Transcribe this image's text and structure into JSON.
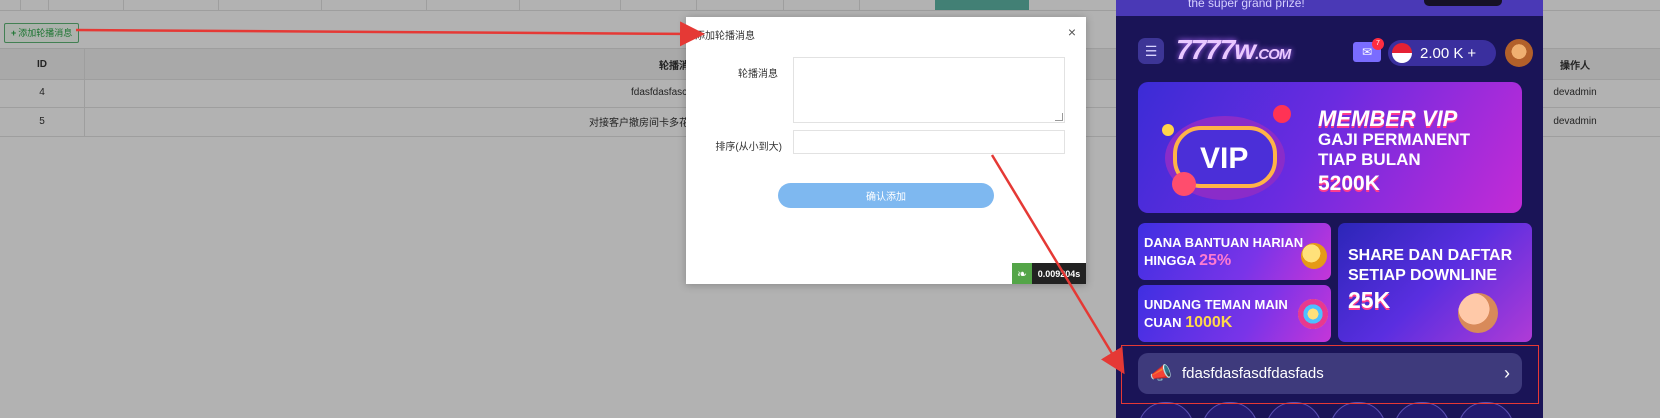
{
  "admin": {
    "add_button_label": "添加轮播消息",
    "table": {
      "headers": {
        "id": "ID",
        "message": "轮播消",
        "operator": "操作人"
      },
      "rows": [
        {
          "id": "4",
          "message": "fdasfdasfasc",
          "operator": "devadmin"
        },
        {
          "id": "5",
          "message": "对接客户撤房间卡多花时",
          "operator": "devadmin"
        }
      ]
    }
  },
  "modal": {
    "title": "添加轮播消息",
    "close_symbol": "×",
    "fields": {
      "message_label": "轮播消息",
      "message_value": "",
      "order_label": "排序(从小到大)",
      "order_value": ""
    },
    "confirm_label": "确认添加",
    "timer": "0.009204s"
  },
  "preview": {
    "top_banner_text": "the super grand prize!",
    "logo": "7777w",
    "logo_domain": ".COM",
    "mail_badge": "7",
    "balance": "2.00 K",
    "balance_plus": "+",
    "main_banner": {
      "title": "MEMBER VIP",
      "line1": "GAJI PERMANENT",
      "line2": "TIAP BULAN",
      "amount": "5200K"
    },
    "promo1": {
      "line1": "DANA BANTUAN HARIAN",
      "line2": "HINGGA",
      "highlight": "25%"
    },
    "promo2": {
      "line1": "UNDANG TEMAN MAIN",
      "line2": "CUAN",
      "highlight": "1000K"
    },
    "promo3": {
      "line1": "SHARE DAN DAFTAR",
      "line2": "SETIAP DOWNLINE",
      "amount": "25K"
    },
    "marquee_text": "fdasfdasfasdfdasfads",
    "colors": {
      "accent": "#5fb878",
      "arrow": "#e53935",
      "confirm": "#7eb8f0",
      "phone_bg": "#1a1457"
    }
  }
}
